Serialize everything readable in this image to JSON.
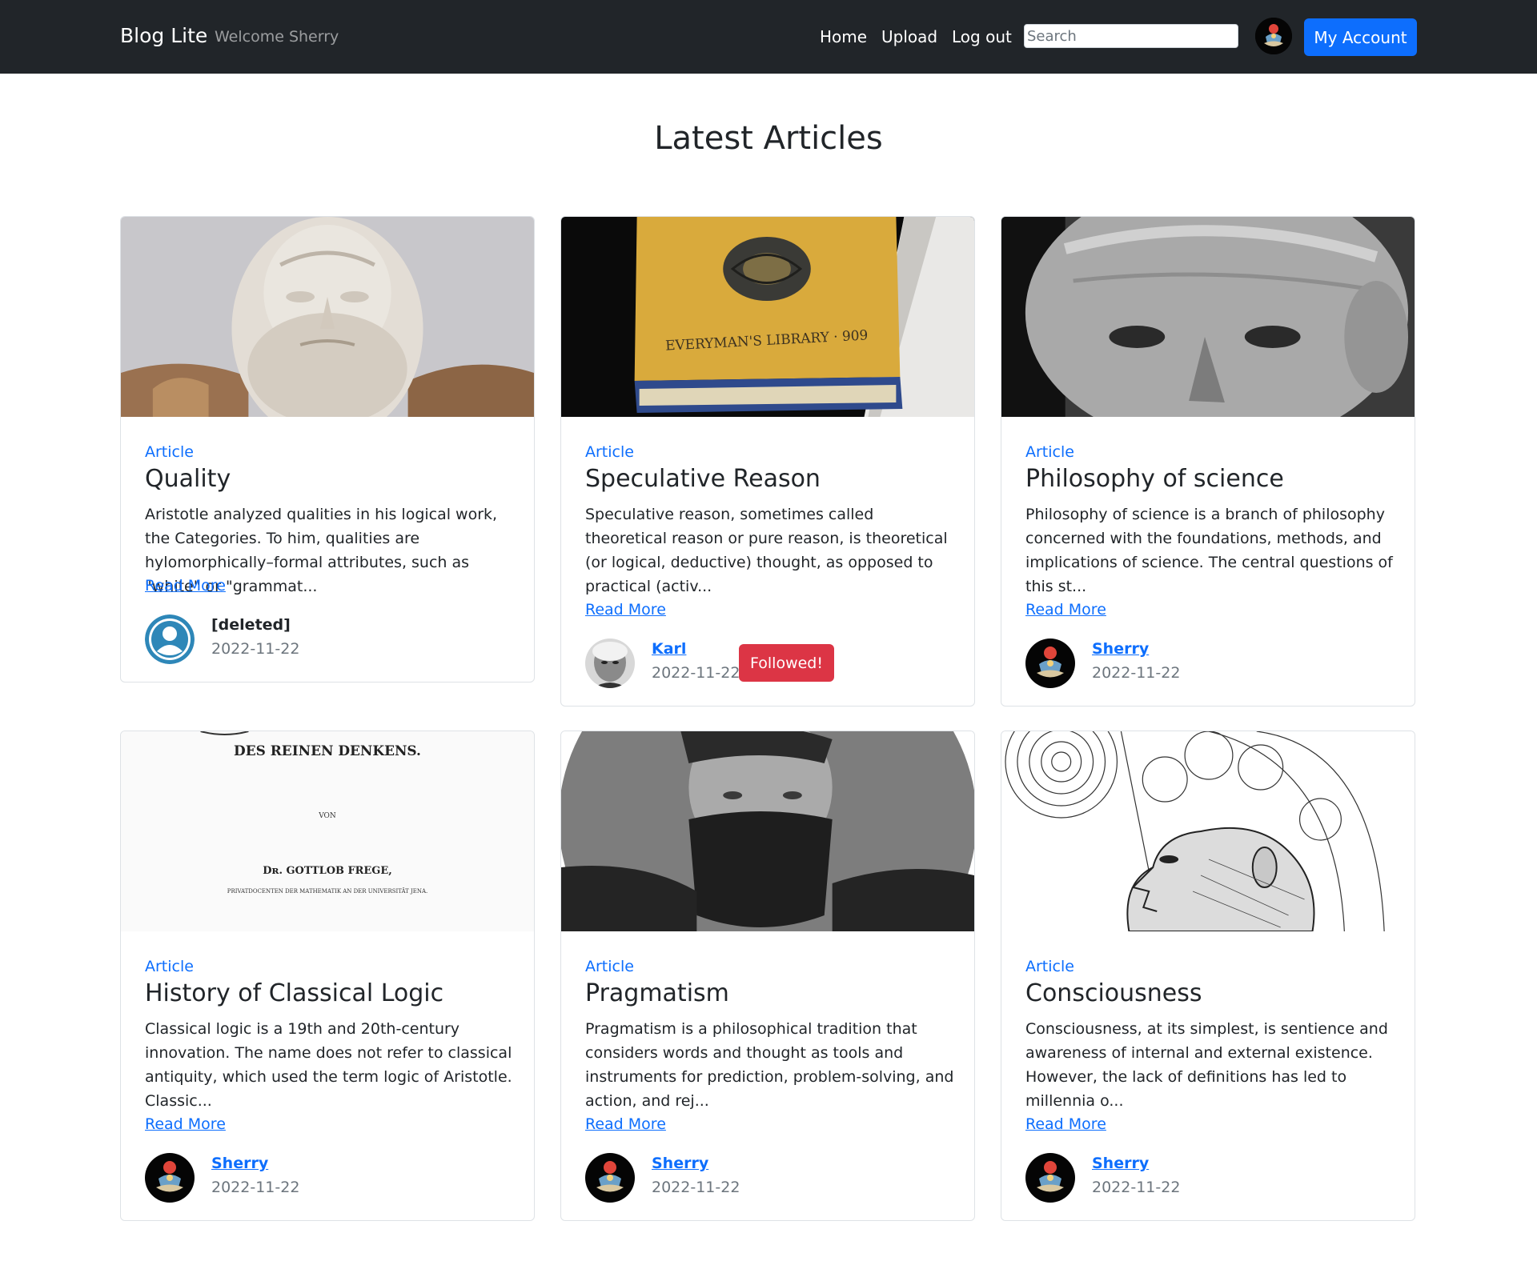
{
  "navbar": {
    "brand": "Blog Lite",
    "welcome": "Welcome Sherry",
    "links": [
      "Home",
      "Upload",
      "Log out"
    ],
    "search_placeholder": "Search",
    "account_button": "My Account"
  },
  "page_title": "Latest Articles",
  "articles": [
    {
      "tag": "Article",
      "title": "Quality",
      "excerpt": "Aristotle analyzed qualities in his logical work, the Categories. To him, qualities are hylomorphically–formal attributes, such as \"white\" or \"grammat...",
      "read_more": "Read More",
      "author": "[deleted]",
      "date": "2022-11-22"
    },
    {
      "tag": "Article",
      "title": "Speculative Reason",
      "excerpt": "Speculative reason, sometimes called theoretical reason or pure reason, is theoretical (or logical, deductive) thought, as opposed to practical (activ...",
      "read_more": "Read More",
      "author": "Karl",
      "date": "2022-11-22",
      "badge": "Followed!"
    },
    {
      "tag": "Article",
      "title": "Philosophy of science",
      "excerpt": "Philosophy of science is a branch of philosophy concerned with the foundations, methods, and implications of science. The central questions of this st...",
      "read_more": "Read More",
      "author": "Sherry",
      "date": "2022-11-22"
    },
    {
      "tag": "Article",
      "title": "History of Classical Logic",
      "excerpt": "Classical logic is a 19th and 20th-century innovation. The name does not refer to classical antiquity, which used the term logic of Aristotle. Classic...",
      "read_more": "Read More",
      "author": "Sherry",
      "date": "2022-11-22",
      "image_text": [
        "DES REINEN DENKENS.",
        "VON",
        "Dʀ. GOTTLOB FREGE,",
        "PRIVATDOCENTEN DER MATHEMATIK AN DER UNIVERSITÄT JENA."
      ]
    },
    {
      "tag": "Article",
      "title": "Pragmatism",
      "excerpt": "Pragmatism is a philosophical tradition that considers words and thought as tools and instruments for prediction, problem-solving, and action, and rej...",
      "read_more": "Read More",
      "author": "Sherry",
      "date": "2022-11-22"
    },
    {
      "tag": "Article",
      "title": "Consciousness",
      "excerpt": "Consciousness, at its simplest, is sentience and awareness of internal and external existence. However, the lack of definitions has led to millennia o...",
      "read_more": "Read More",
      "author": "Sherry",
      "date": "2022-11-22"
    }
  ],
  "book_image_text": "EVERYMAN'S LIBRARY · 909",
  "colors": {
    "navbar": "#212529",
    "primary": "#0d6efd",
    "danger": "#dc3545",
    "muted": "#6c757d"
  }
}
